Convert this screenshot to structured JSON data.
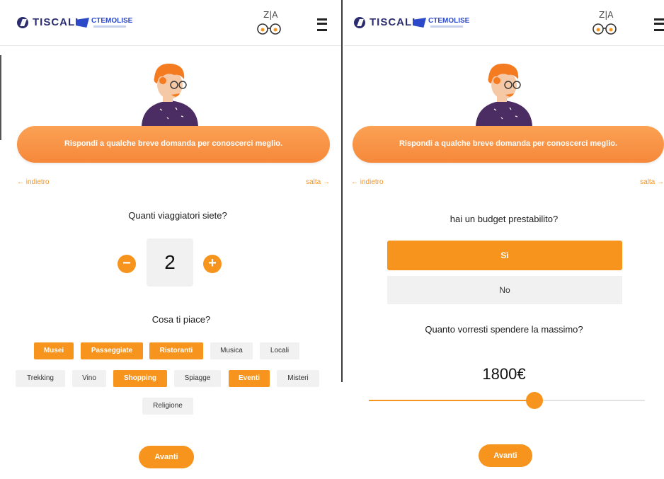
{
  "brand": {
    "tiscali": "TISCALI",
    "cte": "CTEMOLISE",
    "zia": "Z|A"
  },
  "colors": {
    "accent": "#f7941d",
    "banner": "#f88a3b",
    "chip_off": "#f1f1f1"
  },
  "icons": [
    "tiscali-logo-icon",
    "cte-logo-icon",
    "zia-glasses-icon",
    "hamburger-menu-icon",
    "minus-icon",
    "plus-icon"
  ],
  "left": {
    "banner": "Rispondi a qualche breve domanda per conoscerci meglio.",
    "back": "← indietro",
    "skip": "salta →",
    "q_travelers": "Quanti viaggiatori siete?",
    "travelers": "2",
    "minus": "−",
    "plus": "+",
    "q_likes": "Cosa ti piace?",
    "chips": [
      {
        "label": "Musei",
        "selected": true
      },
      {
        "label": "Passeggiate",
        "selected": true
      },
      {
        "label": "Ristoranti",
        "selected": true
      },
      {
        "label": "Musica",
        "selected": false
      },
      {
        "label": "Locali",
        "selected": false
      },
      {
        "label": "Trekking",
        "selected": false
      },
      {
        "label": "Vino",
        "selected": false
      },
      {
        "label": "Shopping",
        "selected": true
      },
      {
        "label": "Spiagge",
        "selected": false
      },
      {
        "label": "Eventi",
        "selected": true
      },
      {
        "label": "Misteri",
        "selected": false
      },
      {
        "label": "Religione",
        "selected": false
      }
    ],
    "next": "Avanti"
  },
  "right": {
    "banner": "Rispondi a qualche breve domanda per conoscerci meglio.",
    "back": "← indietro",
    "skip": "salta →",
    "q_budget": "hai un budget prestabilito?",
    "yes": "Sì",
    "no": "No",
    "q_max": "Quanto vorresti spendere la massimo?",
    "amount": "1800€",
    "slider_fraction": 0.6,
    "next": "Avanti"
  }
}
